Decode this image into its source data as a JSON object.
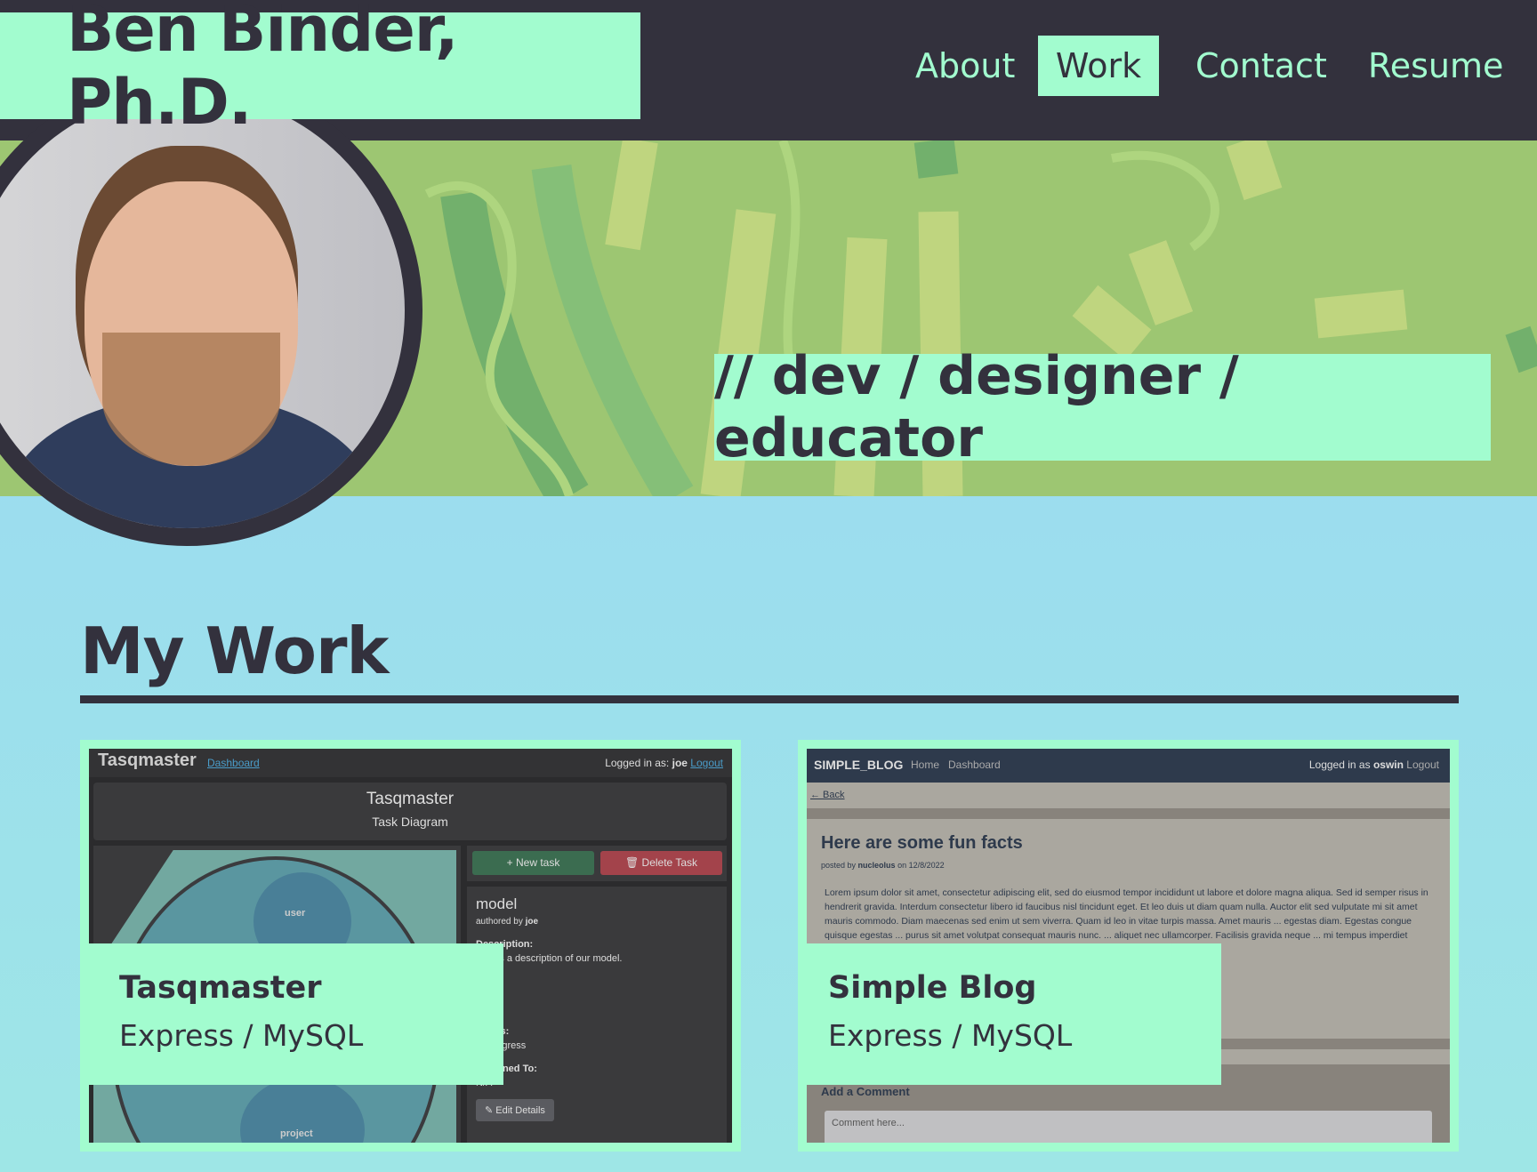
{
  "header": {
    "name": "Ben Binder, Ph.D.",
    "nav": [
      {
        "label": "About"
      },
      {
        "label": "Work",
        "active": true
      },
      {
        "label": "Contact"
      },
      {
        "label": "Resume"
      }
    ]
  },
  "hero": {
    "tagline": "// dev / designer / educator"
  },
  "main": {
    "title": "My Work",
    "projects": [
      {
        "title": "Tasqmaster",
        "stack": "Express / MySQL",
        "shot": {
          "brand": "Tasqmaster",
          "nav_link": "Dashboard",
          "logged_in": "Logged in as:",
          "user": "joe",
          "logout": "Logout",
          "panel_title": "Tasqmaster",
          "panel_sub": "Task Diagram",
          "node_user": "user",
          "node_project": "project",
          "new_task": "New task",
          "delete_task": "Delete Task",
          "task_name": "model",
          "authored_by": "authored by",
          "author": "joe",
          "desc_label": "Description:",
          "desc": "This is a description of our model.",
          "status_label": "Status:",
          "status": "In Progress",
          "assigned_label": "Assigned To:",
          "assigned": "N/A",
          "edit": "Edit Details"
        }
      },
      {
        "title": "Simple Blog",
        "stack": "Express / MySQL",
        "shot": {
          "brand": "SIMPLE_BLOG",
          "home": "Home",
          "dashboard": "Dashboard",
          "logged_in": "Logged in as",
          "user": "oswin",
          "logout": "Logout",
          "back": "← Back",
          "post_title": "Here are some fun facts",
          "posted_by": "posted by",
          "author": "nucleolus",
          "date": "on 12/8/2022",
          "body": "Lorem ipsum dolor sit amet, consectetur adipiscing elit, sed do eiusmod tempor incididunt ut labore et dolore magna aliqua. Sed id semper risus in hendrerit gravida. Interdum consectetur libero id faucibus nisl tincidunt eget. Et leo duis ut diam quam nulla. Auctor elit sed vulputate mi sit amet mauris commodo. Diam maecenas sed enim ut sem viverra. Quam id leo in vitae turpis massa. Amet mauris ... egestas diam. Egestas congue quisque egestas ... purus sit amet volutpat consequat mauris nunc. ... aliquet nec ullamcorper. Facilisis gravida neque ... mi tempus imperdiet nulla. Cursus in hac ... Proin libero nunc consequat interdum varius.",
          "add_comment": "Add a Comment",
          "comment_placeholder": "Comment here..."
        }
      }
    ]
  },
  "colors": {
    "dark": "#33313d",
    "mint": "#a2fccf",
    "hero_green": "#9dc672",
    "sky": "#9ad6f5"
  }
}
